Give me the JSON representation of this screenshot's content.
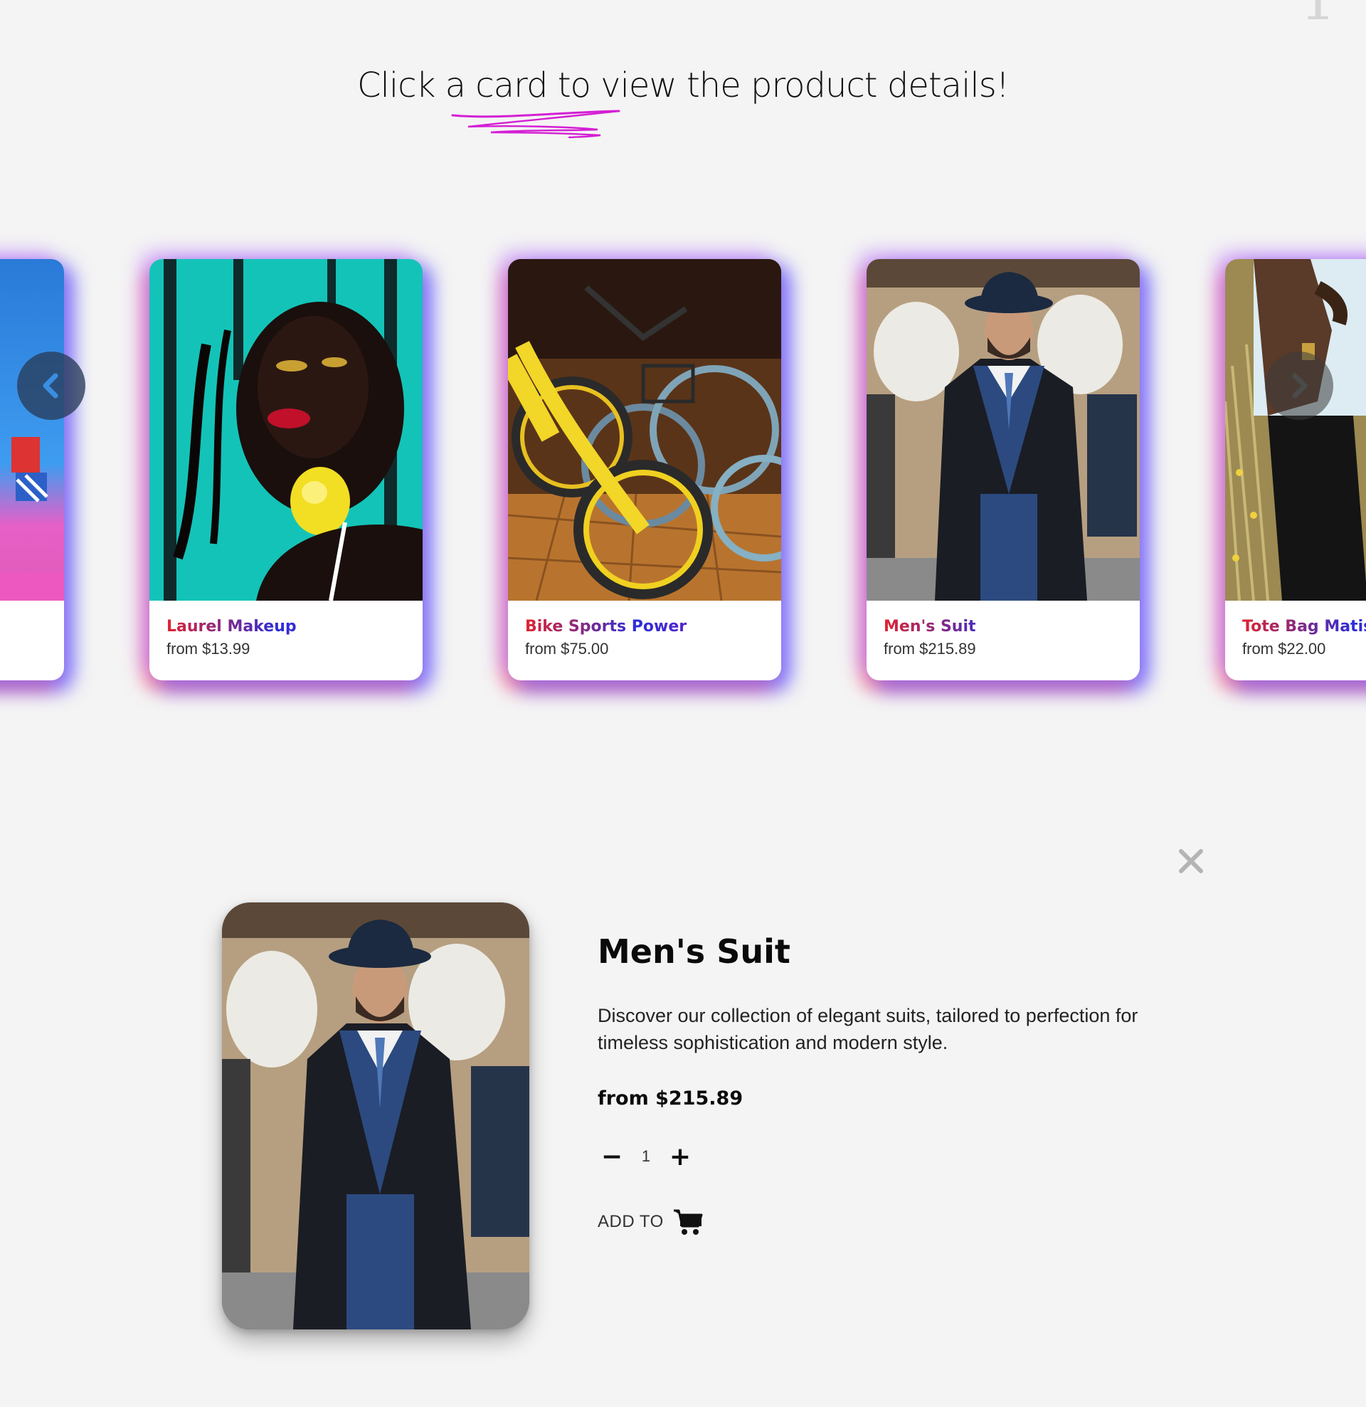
{
  "header": {
    "instruction": "Click a card to view the product details!",
    "corner_glyph": "1"
  },
  "carousel": {
    "cards": [
      {
        "title": "",
        "price": "",
        "image": "toys-on-pink-table"
      },
      {
        "title": "Laurel Makeup",
        "price": "from $13.99",
        "image": "woman-with-lemon-earring"
      },
      {
        "title": "Bike Sports Power",
        "price": "from $75.00",
        "image": "yellow-and-blue-bicycles"
      },
      {
        "title": "Men's Suit",
        "price": "from $215.89",
        "image": "man-in-suit-and-hat"
      },
      {
        "title": "Tote Bag Matiss",
        "price": "from $22.00",
        "image": "person-holding-tote-bag"
      }
    ],
    "prev_icon": "chevron-left-icon",
    "next_icon": "chevron-right-icon"
  },
  "detail": {
    "title": "Men's Suit",
    "description": "Discover our collection of elegant suits, tailored to perfection for timeless sophistication and modern style.",
    "price": "from $215.89",
    "quantity": "1",
    "minus_label": "−",
    "plus_label": "+",
    "add_to_label": "ADD TO",
    "cart_icon": "shopping-cart-icon",
    "close_icon": "close-icon",
    "image": "man-in-suit-and-hat"
  },
  "colors": {
    "background": "#f4f4f4",
    "scribble": "#d41fd4",
    "title_gradient": [
      "#e0232f",
      "#2b2ed8",
      "#6a1cc4",
      "#c48ad8"
    ]
  }
}
